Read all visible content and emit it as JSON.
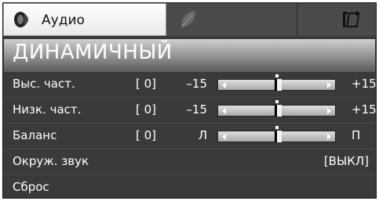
{
  "tabs": [
    {
      "id": "audio",
      "label": "Аудио",
      "icon": "speaker-icon",
      "active": true
    },
    {
      "id": "eco",
      "label": "",
      "icon": "leaf-icon",
      "active": false
    },
    {
      "id": "setup",
      "label": "",
      "icon": "tools-icon",
      "active": false
    }
  ],
  "header": {
    "title": "ДИНАМИЧНЫЙ"
  },
  "sliders": [
    {
      "label": "Выс. част.",
      "value": "[  0]",
      "min_label": "–15",
      "max_label": "+15",
      "min": -15,
      "max": 15,
      "current": 0
    },
    {
      "label": "Низк. част.",
      "value": "[  0]",
      "min_label": "–15",
      "max_label": "+15",
      "min": -15,
      "max": 15,
      "current": 0
    },
    {
      "label": "Баланс",
      "value": "[  0]",
      "min_label": "Л",
      "max_label": "П",
      "min": -15,
      "max": 15,
      "current": 0
    }
  ],
  "surround": {
    "label": "Окруж. звук",
    "value": "[ВЫКЛ]"
  },
  "reset": {
    "label": "Сброс"
  },
  "colors": {
    "panel": "#3a3a3a",
    "header_top": "#d0d0d0",
    "header_bottom": "#5a5a5a",
    "slider_track": "#c0c0c0",
    "text": "#ffffff"
  }
}
